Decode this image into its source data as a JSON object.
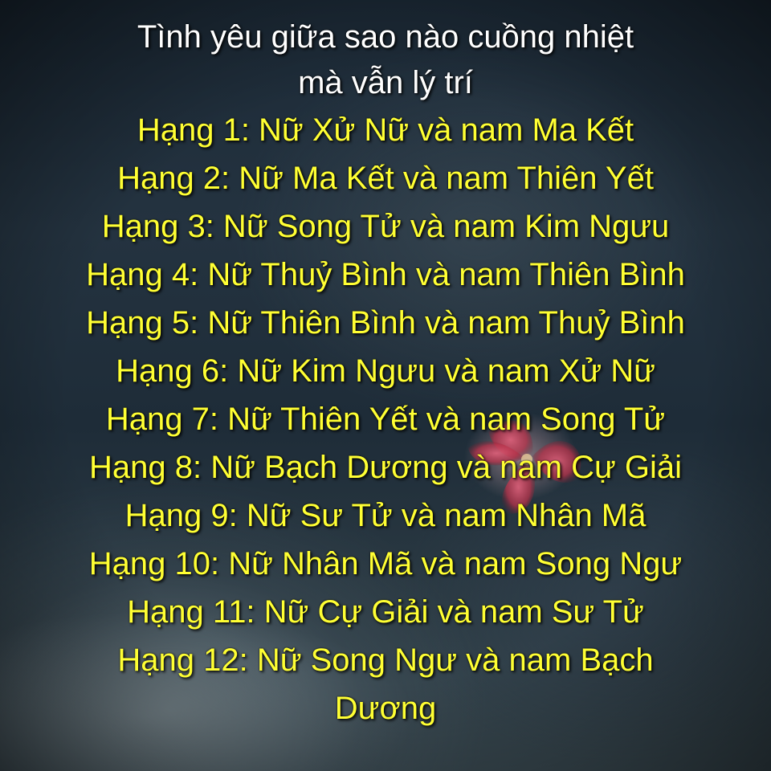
{
  "title": {
    "line1": "Tình yêu giữa sao nào cuồng nhiệt",
    "line2": "mà vẫn lý trí"
  },
  "rankings": [
    "Hạng 1: Nữ Xử Nữ và nam Ma Kết",
    "Hạng 2: Nữ Ma Kết và nam Thiên Yết",
    "Hạng 3: Nữ Song Tử và nam Kim Ngưu",
    "Hạng 4: Nữ Thuỷ Bình và nam Thiên Bình",
    "Hạng 5: Nữ Thiên Bình và nam Thuỷ Bình",
    "Hạng 6: Nữ Kim Ngưu và nam Xử Nữ",
    "Hạng 7: Nữ Thiên Yết và nam Song Tử",
    "Hạng 8: Nữ Bạch Dương và nam Cự Giải",
    "Hạng 9: Nữ Sư Tử và nam Nhân Mã",
    "Hạng 10: Nữ Nhân Mã và nam Song Ngư",
    "Hạng 11: Nữ Cự Giải và nam Sư Tử"
  ],
  "last_ranking": {
    "line1": "Hạng 12: Nữ Song Ngư và nam Bạch",
    "line2": "Dương"
  },
  "colors": {
    "title_text": "#ffffff",
    "ranking_text": "#ffff33",
    "background": "#1e2c38",
    "flower": "#b8324a"
  },
  "background_image": "dark misty night scene with a red flower"
}
